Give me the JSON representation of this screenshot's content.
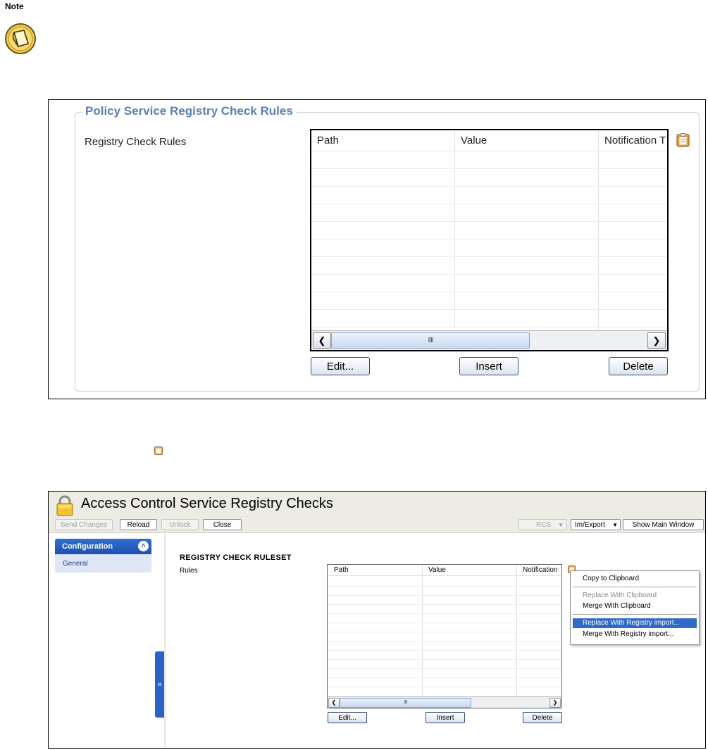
{
  "note": {
    "label": "Note"
  },
  "panel1": {
    "group_title": "Policy Service Registry Check Rules",
    "rules_label": "Registry Check Rules",
    "columns": [
      "Path",
      "Value",
      "Notification T"
    ],
    "scroll_thumb": "IIII",
    "buttons": {
      "edit": "Edit...",
      "insert": "Insert",
      "delete": "Delete"
    }
  },
  "panel2": {
    "title": "Access Control Service Registry Checks",
    "toolbar": {
      "send_changes": "Send Changes",
      "reload": "Reload",
      "unlock": "Unlock",
      "close": "Close",
      "rcs": "RCS",
      "im_export": "Im/Export",
      "show_main_window": "Show Main Window"
    },
    "sidebar": {
      "header": "Configuration",
      "items": [
        "General"
      ],
      "handle": "«"
    },
    "ruleset_title": "REGISTRY CHECK RULESET",
    "rules_label": "Rules",
    "columns": [
      "Path",
      "Value",
      "Notification"
    ],
    "scroll_thumb": "IIII",
    "buttons": {
      "edit": "Edit...",
      "insert": "Insert",
      "delete": "Delete"
    },
    "context_menu": {
      "copy": "Copy to Clipboard",
      "replace_clipboard": "Replace With Clipboard",
      "merge_clipboard": "Merge With Clipboard",
      "replace_registry": "Replace With Registry import...",
      "merge_registry": "Merge With Registry import..."
    }
  },
  "colors": {
    "accent_blue": "#2b62c8",
    "legend_blue": "#5a7fb5",
    "menu_highlight": "#3169c6"
  }
}
